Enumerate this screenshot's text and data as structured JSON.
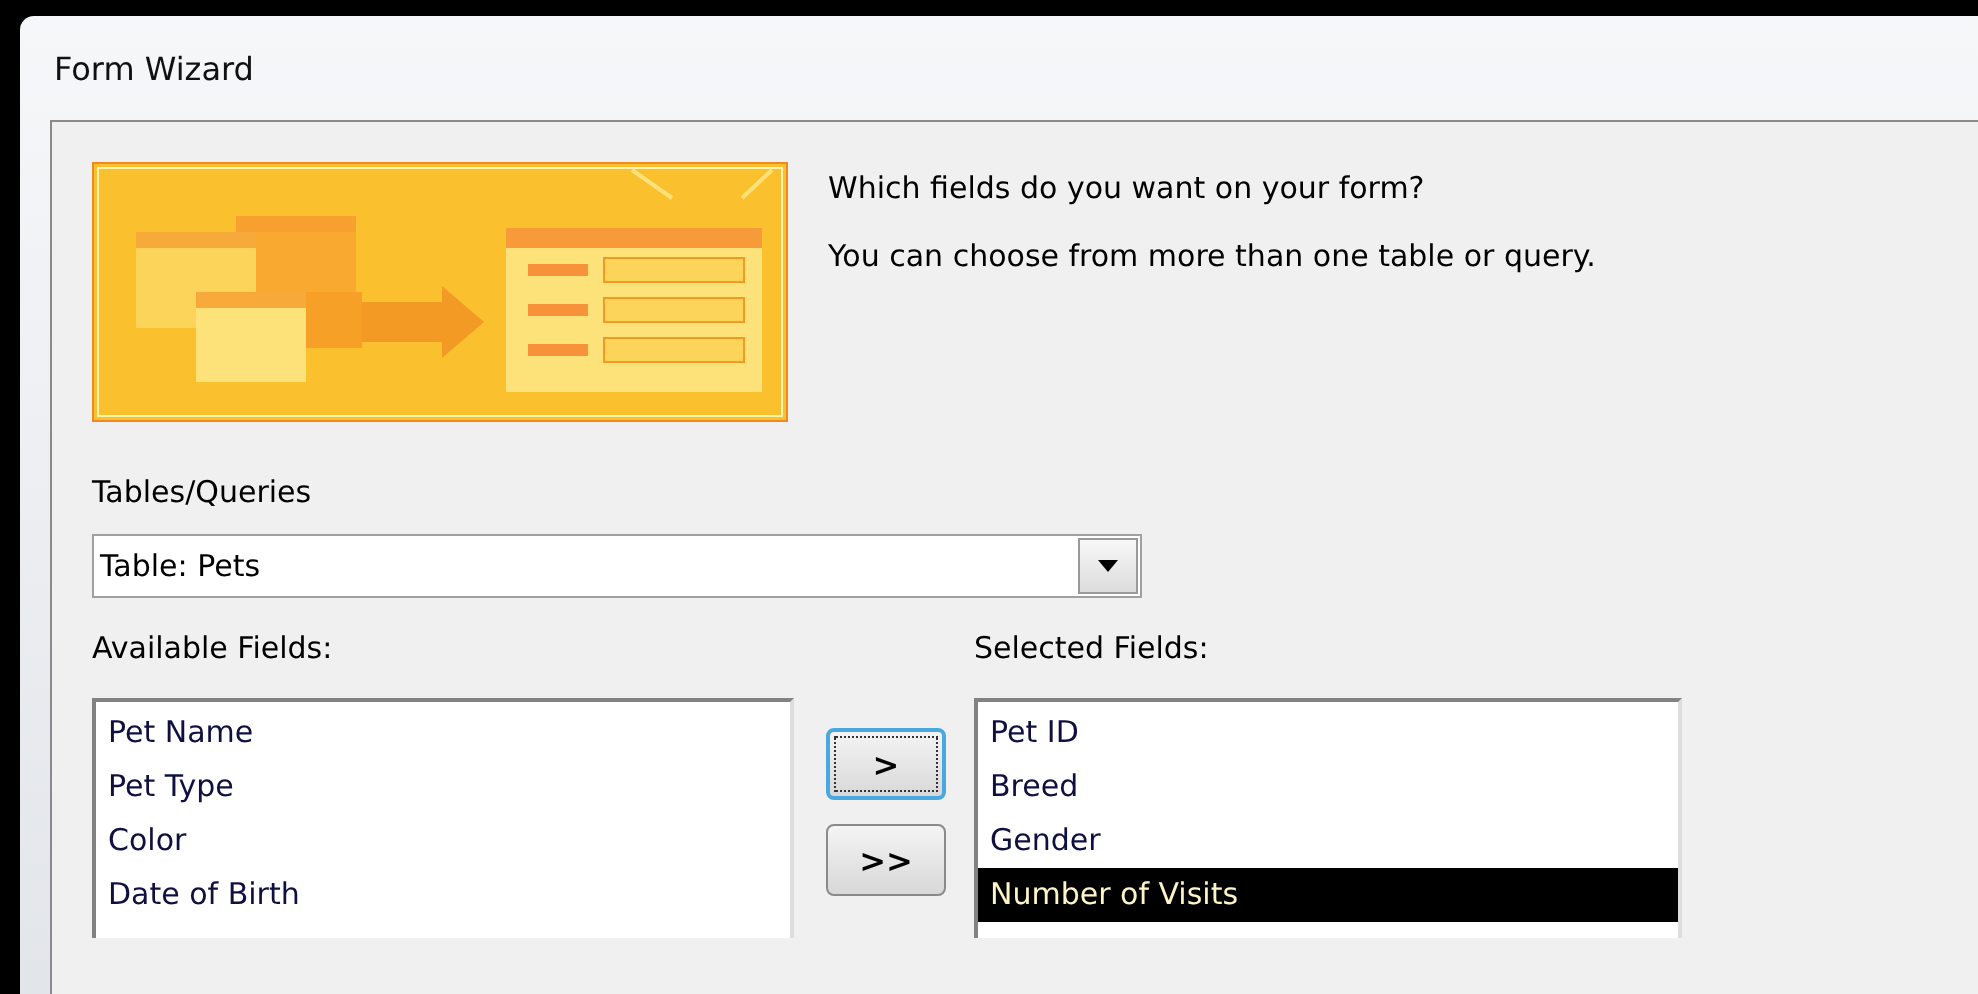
{
  "window": {
    "title": "Form Wizard"
  },
  "intro": {
    "question": "Which fields do you want on your form?",
    "hint": "You can choose from more than one table or query."
  },
  "tables_queries": {
    "label": "Tables/Queries",
    "value": "Table: Pets"
  },
  "available_fields": {
    "label": "Available Fields:",
    "items": [
      {
        "label": "Pet Name",
        "selected": false
      },
      {
        "label": "Pet Type",
        "selected": false
      },
      {
        "label": "Color",
        "selected": false
      },
      {
        "label": "Date of Birth",
        "selected": false
      }
    ]
  },
  "move_buttons": [
    {
      "label": ">",
      "focused": true
    },
    {
      "label": ">>",
      "focused": false
    }
  ],
  "selected_fields": {
    "label": "Selected Fields:",
    "items": [
      {
        "label": "Pet ID",
        "selected": false
      },
      {
        "label": "Breed",
        "selected": false
      },
      {
        "label": "Gender",
        "selected": false
      },
      {
        "label": "Number of Visits",
        "selected": true
      }
    ]
  }
}
